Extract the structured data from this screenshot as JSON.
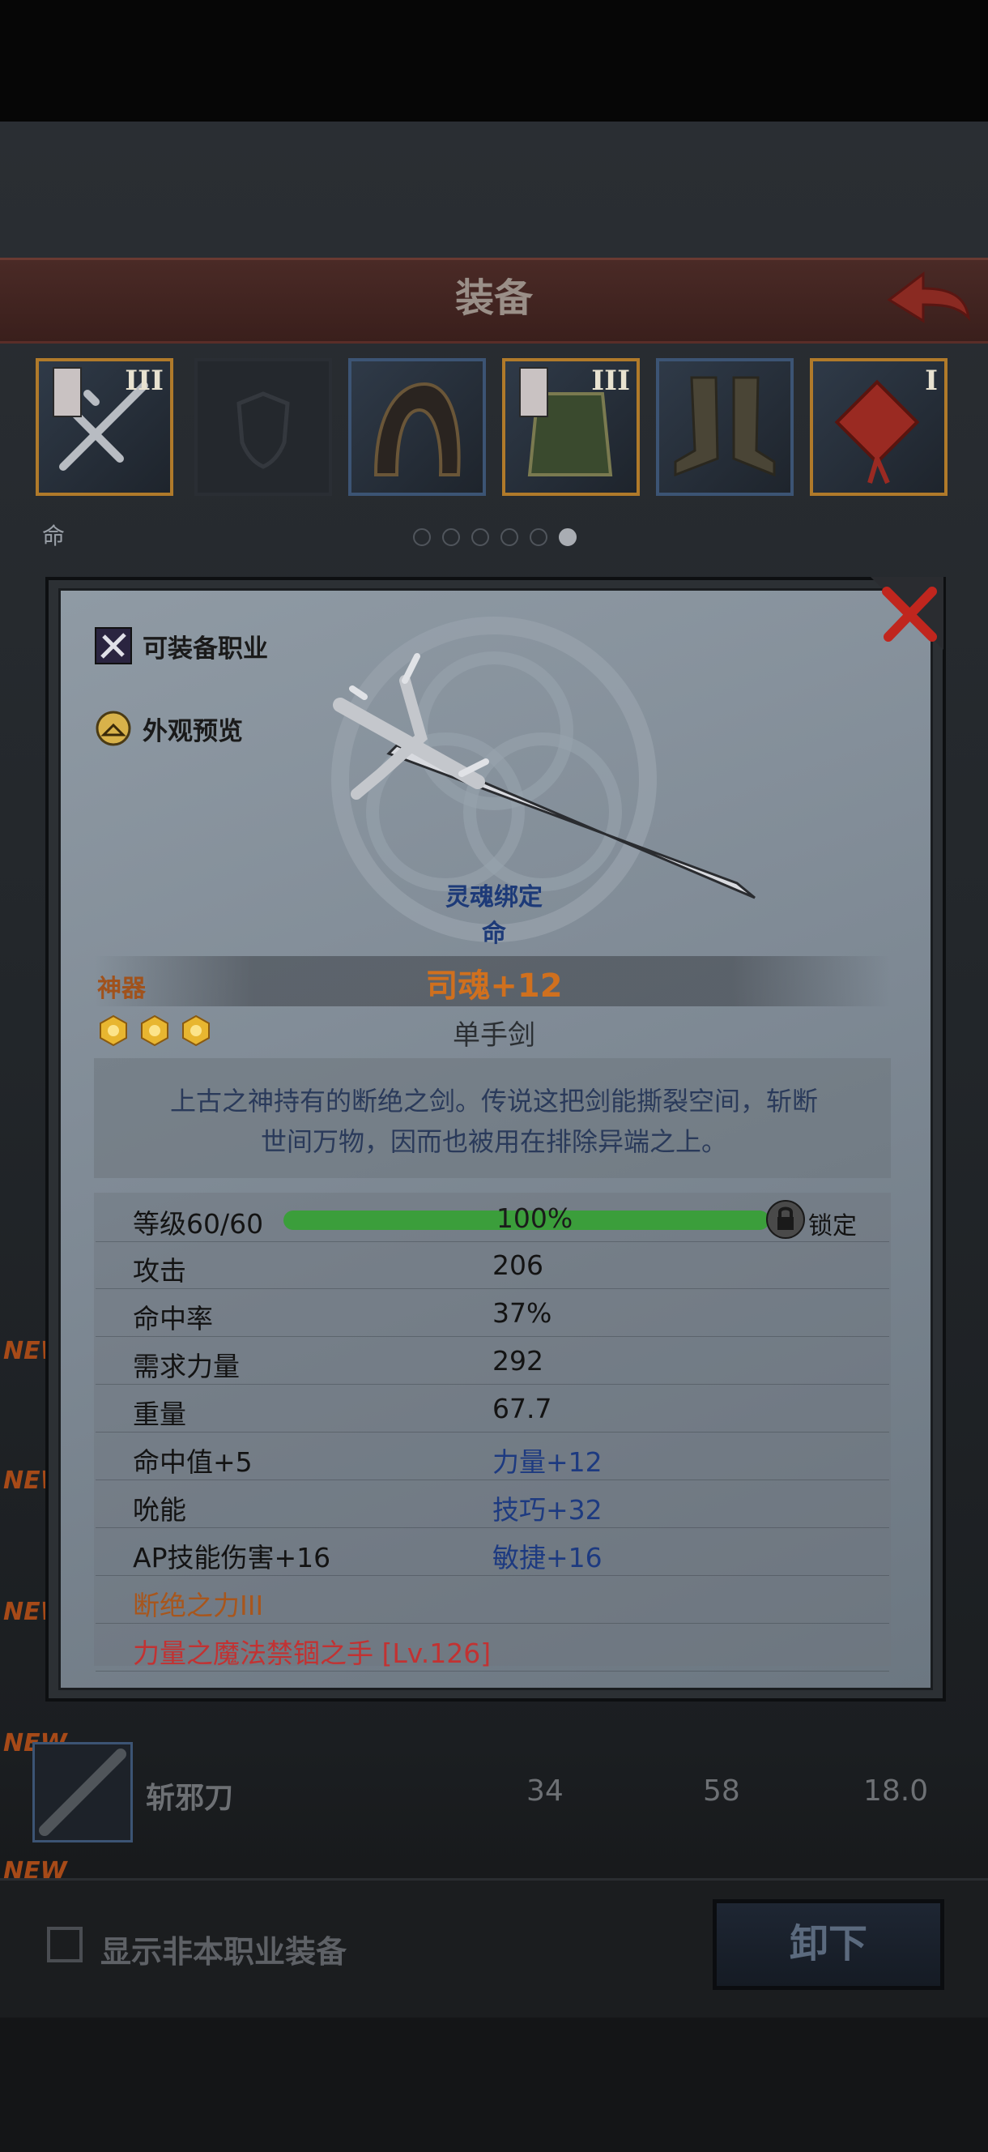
{
  "header": {
    "title": "装备"
  },
  "slots": [
    {
      "tier": "III"
    },
    {
      "tier": ""
    },
    {
      "tier": ""
    },
    {
      "tier": "III"
    },
    {
      "tier": ""
    },
    {
      "tier": "I"
    }
  ],
  "soul_tag": "命",
  "pager": {
    "count": 6,
    "active": 6
  },
  "detail": {
    "job_button": "可装备职业",
    "preview_button": "外观预览",
    "bind_label": "灵魂绑定",
    "bind_sub": "命",
    "rarity": "神器",
    "name": "司魂+12",
    "type": "单手剑",
    "stars": 3,
    "description_line1": "上古之神持有的断绝之剑。传说这把剑能撕裂空间，斩断",
    "description_line2": "世间万物，因而也被用在排除异端之上。",
    "level_label": "等级60/60",
    "level_progress": 1.0,
    "level_pct": "100%",
    "lock_label": "锁定",
    "stats": [
      {
        "l": "攻击",
        "r": "206"
      },
      {
        "l": "命中率",
        "r": "37%"
      },
      {
        "l": "需求力量",
        "r": "292"
      },
      {
        "l": "重量",
        "r": "67.7"
      },
      {
        "l": "命中值+5",
        "r": "力量+12"
      },
      {
        "l": "吮能",
        "r": "技巧+32"
      },
      {
        "l": "AP技能伤害+16",
        "r": "敏捷+16"
      },
      {
        "l": "断绝之力III",
        "r": ""
      },
      {
        "l": "力量之魔法禁锢之手 [Lv.126]",
        "r": ""
      }
    ]
  },
  "list": {
    "new_tag": "NEW",
    "row": {
      "name": "斩邪刀",
      "v1": "34",
      "v2": "58",
      "v3": "18.0"
    }
  },
  "footer": {
    "checkbox_label": "显示非本职业装备",
    "unequip_button": "卸下"
  }
}
